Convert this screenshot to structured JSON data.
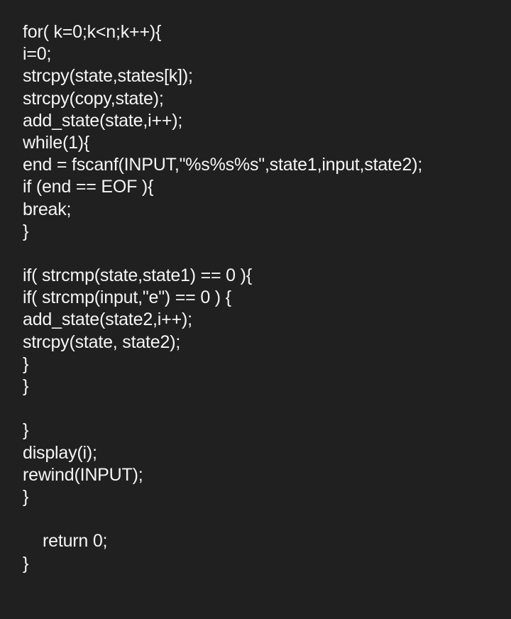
{
  "code": {
    "lines": [
      "for( k=0;k<n;k++){",
      "i=0;",
      "strcpy(state,states[k]);",
      "strcpy(copy,state);",
      "add_state(state,i++);",
      "while(1){",
      "end = fscanf(INPUT,\"%s%s%s\",state1,input,state2);",
      "if (end == EOF ){",
      "break;",
      "}",
      "",
      "if( strcmp(state,state1) == 0 ){",
      "if( strcmp(input,\"e\") == 0 ) {",
      "add_state(state2,i++);",
      "strcpy(state, state2);",
      "}",
      "}",
      "",
      "}",
      "display(i);",
      "rewind(INPUT);",
      "}",
      "",
      "return 0;",
      "}"
    ]
  }
}
